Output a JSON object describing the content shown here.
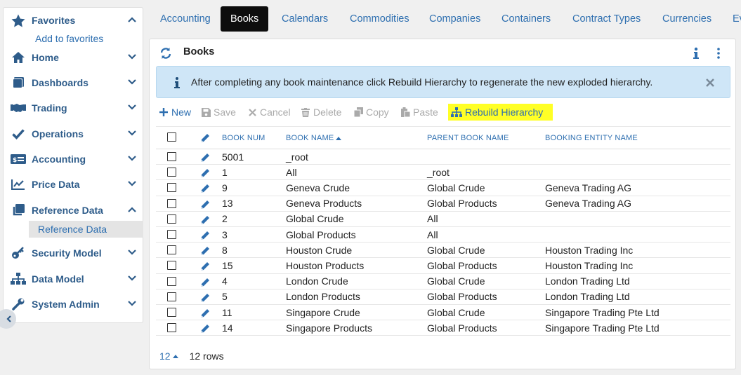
{
  "colors": {
    "link": "#2e6fb0",
    "nav_label": "#2e5c8a",
    "active_tab_bg": "#0d0d0d",
    "alert_bg": "#cfe6f7",
    "highlight": "#ffff26"
  },
  "sidebar": {
    "items": [
      {
        "label": "Favorites",
        "icon": "star-icon",
        "expanded": true
      },
      {
        "label": "Home",
        "icon": "home-icon",
        "expanded": false
      },
      {
        "label": "Dashboards",
        "icon": "dashboard-icon",
        "expanded": false
      },
      {
        "label": "Trading",
        "icon": "handshake-icon",
        "expanded": false
      },
      {
        "label": "Operations",
        "icon": "check-icon",
        "expanded": false
      },
      {
        "label": "Accounting",
        "icon": "money-icon",
        "expanded": false
      },
      {
        "label": "Price Data",
        "icon": "chart-line-icon",
        "expanded": false
      },
      {
        "label": "Reference Data",
        "icon": "clone-icon",
        "expanded": true
      },
      {
        "label": "Security Model",
        "icon": "key-icon",
        "expanded": false
      },
      {
        "label": "Data Model",
        "icon": "sitemap-icon",
        "expanded": false
      },
      {
        "label": "System Admin",
        "icon": "wrench-icon",
        "expanded": false
      }
    ],
    "favorites_sub": "Add to favorites",
    "reference_sub": "Reference Data"
  },
  "tabs": [
    "Accounting",
    "Books",
    "Calendars",
    "Commodities",
    "Companies",
    "Containers",
    "Contract Types",
    "Currencies",
    "Ev"
  ],
  "active_tab": "Books",
  "panel": {
    "title": "Books",
    "alert": "After completing any book maintenance click Rebuild Hierarchy to regenerate the new exploded hierarchy."
  },
  "toolbar": {
    "new": "New",
    "save": "Save",
    "cancel": "Cancel",
    "delete": "Delete",
    "copy": "Copy",
    "paste": "Paste",
    "rebuild": "Rebuild Hierarchy"
  },
  "table": {
    "columns": [
      "BOOK NUM",
      "BOOK NAME",
      "PARENT BOOK NAME",
      "BOOKING ENTITY NAME"
    ],
    "rows": [
      [
        "5001",
        "_root",
        "",
        ""
      ],
      [
        "1",
        "All",
        "_root",
        ""
      ],
      [
        "9",
        "Geneva Crude",
        "Global Crude",
        "Geneva Trading AG"
      ],
      [
        "13",
        "Geneva Products",
        "Global Products",
        "Geneva Trading AG"
      ],
      [
        "2",
        "Global Crude",
        "All",
        ""
      ],
      [
        "3",
        "Global Products",
        "All",
        ""
      ],
      [
        "8",
        "Houston Crude",
        "Global Crude",
        "Houston Trading Inc"
      ],
      [
        "15",
        "Houston Products",
        "Global Products",
        "Houston Trading Inc"
      ],
      [
        "4",
        "London Crude",
        "Global Crude",
        "London Trading Ltd"
      ],
      [
        "5",
        "London Products",
        "Global Products",
        "London Trading Ltd"
      ],
      [
        "11",
        "Singapore Crude",
        "Global Crude",
        "Singapore Trading Pte Ltd"
      ],
      [
        "14",
        "Singapore Products",
        "Global Products",
        "Singapore Trading Pte Ltd"
      ]
    ]
  },
  "footer": {
    "page_size": "12",
    "row_count": "12 rows"
  }
}
